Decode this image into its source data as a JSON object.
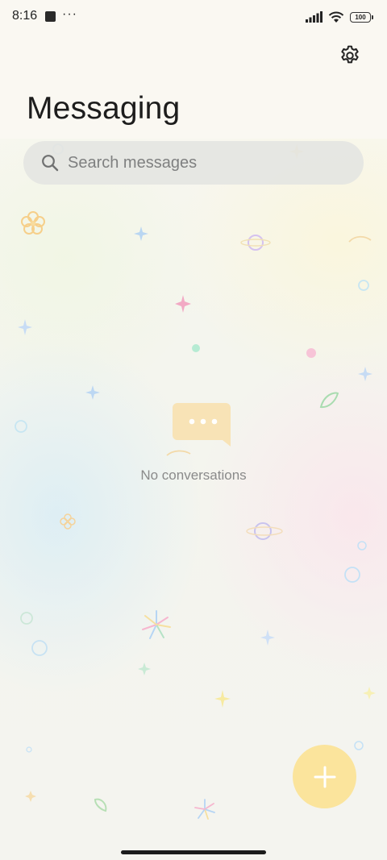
{
  "status_bar": {
    "time": "8:16",
    "more": "···",
    "battery": "100"
  },
  "header": {
    "title": "Messaging",
    "settings_icon": "gear-icon"
  },
  "search": {
    "placeholder": "Search messages",
    "icon": "search-icon"
  },
  "empty_state": {
    "icon": "chat-bubble-icon",
    "text": "No conversations"
  },
  "fab": {
    "icon": "plus-icon",
    "color": "#fbe49c"
  },
  "colors": {
    "accent": "#fbe49c",
    "empty_icon": "#f8e3b6",
    "text_primary": "#1d1d1d",
    "text_secondary": "#8a8a8a"
  }
}
